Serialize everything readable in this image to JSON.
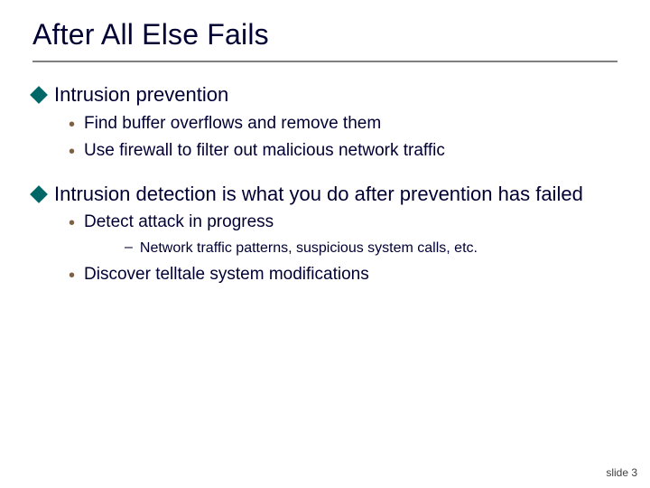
{
  "title": "After All Else Fails",
  "topics": [
    {
      "heading": "Intrusion prevention",
      "subs": [
        {
          "text": "Find buffer overflows and remove them"
        },
        {
          "text": "Use firewall to filter out malicious network traffic"
        }
      ]
    },
    {
      "heading": "Intrusion detection is what you do after prevention has failed",
      "subs": [
        {
          "text": "Detect attack in progress",
          "subsubs": [
            {
              "text": "Network traffic patterns, suspicious system calls, etc."
            }
          ]
        },
        {
          "text": "Discover telltale system modifications"
        }
      ]
    }
  ],
  "footer": "slide 3"
}
